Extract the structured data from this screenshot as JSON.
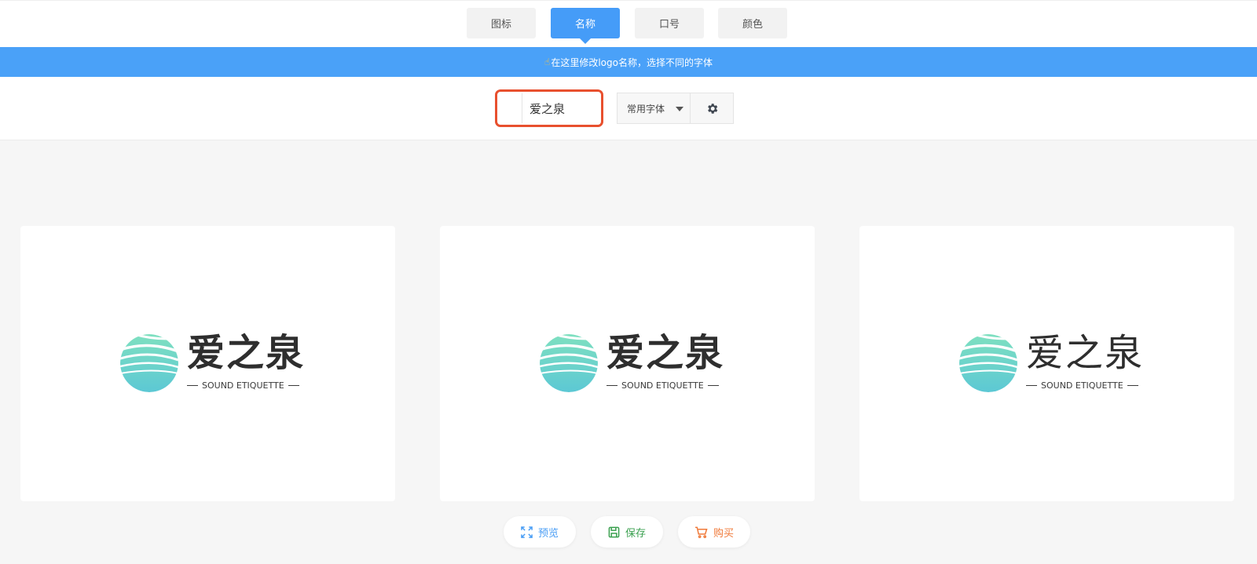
{
  "tabs": [
    {
      "label": "图标",
      "active": false
    },
    {
      "label": "名称",
      "active": true
    },
    {
      "label": "口号",
      "active": false
    },
    {
      "label": "颜色",
      "active": false
    }
  ],
  "hint": {
    "text": "在这里修改logo名称，选择不同的字体",
    "icon": "pointing-hand-icon"
  },
  "editor": {
    "name_value": "爱之泉",
    "font_select_label": "常用字体",
    "settings_icon": "gear-icon"
  },
  "cards": [
    {
      "title": "爱之泉",
      "subtitle": "SOUND ETIQUETTE",
      "style": "bold"
    },
    {
      "title": "爱之泉",
      "subtitle": "SOUND ETIQUETTE",
      "style": "bold"
    },
    {
      "title": "爱之泉",
      "subtitle": "SOUND ETIQUETTE",
      "style": "regular"
    }
  ],
  "actions": {
    "preview": {
      "label": "预览",
      "color": "#4a9ef5",
      "icon": "expand-icon"
    },
    "save": {
      "label": "保存",
      "color": "#3aa04f",
      "icon": "save-icon"
    },
    "buy": {
      "label": "购买",
      "color": "#f07a3a",
      "icon": "cart-icon"
    }
  },
  "colors": {
    "accent": "#459cf8",
    "highlight_border": "#e8502e",
    "logo_gradient_top": "#7fe0c0",
    "logo_gradient_bottom": "#5cc8d4"
  }
}
